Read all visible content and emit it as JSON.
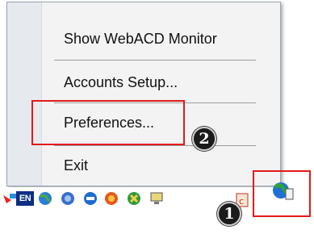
{
  "menu": {
    "items": [
      {
        "label": "Show WebACD Monitor"
      },
      {
        "label": "Accounts Setup..."
      },
      {
        "label": "Preferences..."
      },
      {
        "label": "Exit"
      }
    ]
  },
  "callouts": {
    "step1": "1",
    "step2": "2"
  },
  "taskbar": {
    "language_indicator": "EN",
    "icons": [
      "network-icon",
      "globe-icon",
      "shield-icon",
      "volume-icon",
      "messenger-icon",
      "computer-icon",
      "webacd-tray-icon",
      "webacd-globe-icon"
    ]
  },
  "colors": {
    "highlight": "#e3191b",
    "menu_background": "#f3f3f3",
    "language_badge": "#0c2e84"
  }
}
